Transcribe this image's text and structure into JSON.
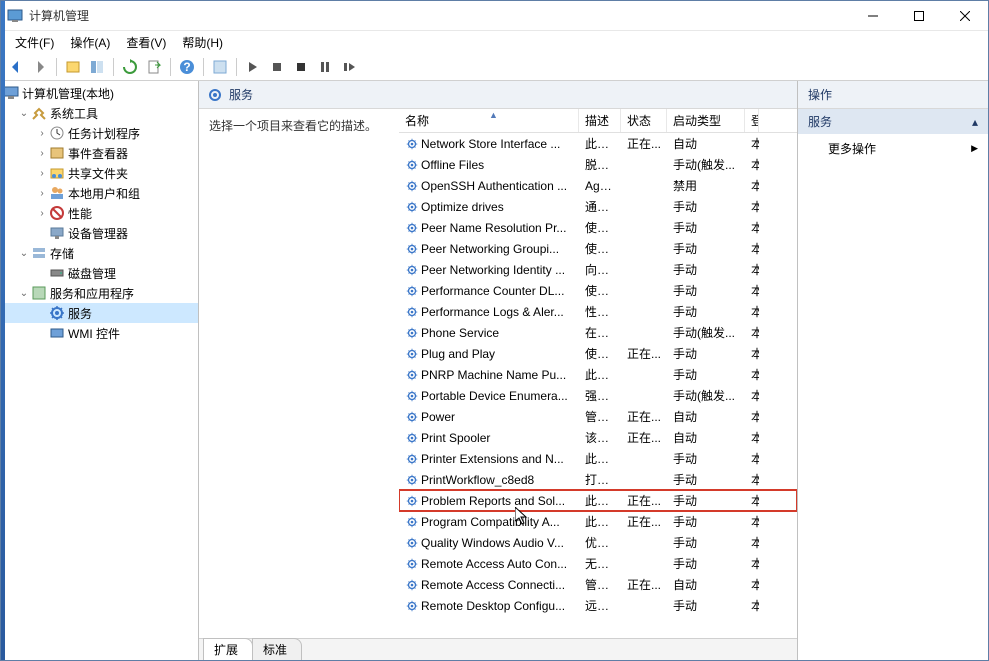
{
  "titlebar": {
    "title": "计算机管理"
  },
  "menubar": {
    "file": "文件(F)",
    "action": "操作(A)",
    "view": "查看(V)",
    "help": "帮助(H)"
  },
  "tree": {
    "root": "计算机管理(本地)",
    "system_tools": "系统工具",
    "task_scheduler": "任务计划程序",
    "event_viewer": "事件查看器",
    "shared_folders": "共享文件夹",
    "local_users": "本地用户和组",
    "performance": "性能",
    "device_manager": "设备管理器",
    "storage": "存储",
    "disk_management": "磁盘管理",
    "services_apps": "服务和应用程序",
    "services": "服务",
    "wmi": "WMI 控件"
  },
  "center": {
    "header_title": "服务",
    "description_prompt": "选择一个项目来查看它的描述。",
    "columns": {
      "name": "名称",
      "desc": "描述",
      "status": "状态",
      "startup": "启动类型",
      "logon": "登"
    },
    "tabs": {
      "extended": "扩展",
      "standard": "标准"
    }
  },
  "services": [
    {
      "name": "Network Store Interface ...",
      "desc": "此服...",
      "status": "正在...",
      "startup": "自动",
      "logon": "本"
    },
    {
      "name": "Offline Files",
      "desc": "脱机...",
      "status": "",
      "startup": "手动(触发...",
      "logon": "本"
    },
    {
      "name": "OpenSSH Authentication ...",
      "desc": "Age...",
      "status": "",
      "startup": "禁用",
      "logon": "本"
    },
    {
      "name": "Optimize drives",
      "desc": "通过...",
      "status": "",
      "startup": "手动",
      "logon": "本"
    },
    {
      "name": "Peer Name Resolution Pr...",
      "desc": "使用...",
      "status": "",
      "startup": "手动",
      "logon": "本"
    },
    {
      "name": "Peer Networking Groupi...",
      "desc": "使用...",
      "status": "",
      "startup": "手动",
      "logon": "本"
    },
    {
      "name": "Peer Networking Identity ...",
      "desc": "向对...",
      "status": "",
      "startup": "手动",
      "logon": "本"
    },
    {
      "name": "Performance Counter DL...",
      "desc": "使远...",
      "status": "",
      "startup": "手动",
      "logon": "本"
    },
    {
      "name": "Performance Logs & Aler...",
      "desc": "性能...",
      "status": "",
      "startup": "手动",
      "logon": "本"
    },
    {
      "name": "Phone Service",
      "desc": "在设...",
      "status": "",
      "startup": "手动(触发...",
      "logon": "本"
    },
    {
      "name": "Plug and Play",
      "desc": "使计...",
      "status": "正在...",
      "startup": "手动",
      "logon": "本"
    },
    {
      "name": "PNRP Machine Name Pu...",
      "desc": "此服...",
      "status": "",
      "startup": "手动",
      "logon": "本"
    },
    {
      "name": "Portable Device Enumera...",
      "desc": "强制...",
      "status": "",
      "startup": "手动(触发...",
      "logon": "本"
    },
    {
      "name": "Power",
      "desc": "管理...",
      "status": "正在...",
      "startup": "自动",
      "logon": "本"
    },
    {
      "name": "Print Spooler",
      "desc": "该服...",
      "status": "正在...",
      "startup": "自动",
      "logon": "本"
    },
    {
      "name": "Printer Extensions and N...",
      "desc": "此服...",
      "status": "",
      "startup": "手动",
      "logon": "本"
    },
    {
      "name": "PrintWorkflow_c8ed8",
      "desc": "打印...",
      "status": "",
      "startup": "手动",
      "logon": "本"
    },
    {
      "name": "Problem Reports and Sol...",
      "desc": "此服...",
      "status": "正在...",
      "startup": "手动",
      "logon": "本",
      "hl": true
    },
    {
      "name": "Program Compatibility A...",
      "desc": "此服...",
      "status": "正在...",
      "startup": "手动",
      "logon": "本"
    },
    {
      "name": "Quality Windows Audio V...",
      "desc": "优质...",
      "status": "",
      "startup": "手动",
      "logon": "本"
    },
    {
      "name": "Remote Access Auto Con...",
      "desc": "无论...",
      "status": "",
      "startup": "手动",
      "logon": "本"
    },
    {
      "name": "Remote Access Connecti...",
      "desc": "管理...",
      "status": "正在...",
      "startup": "自动",
      "logon": "本"
    },
    {
      "name": "Remote Desktop Configu...",
      "desc": "远程...",
      "status": "",
      "startup": "手动",
      "logon": "本"
    }
  ],
  "right": {
    "header": "操作",
    "section": "服务",
    "more": "更多操作"
  },
  "icons": {
    "gear_color": "#3a76c8",
    "arrow_up": "▴",
    "arrow_right": "▶"
  }
}
